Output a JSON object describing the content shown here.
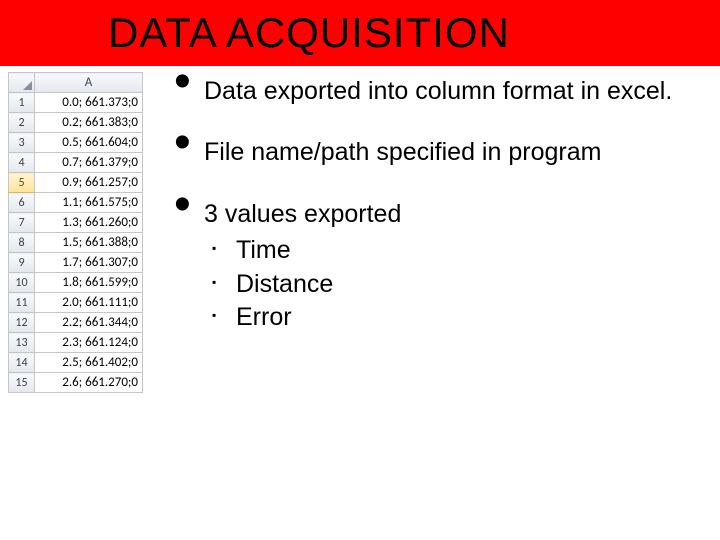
{
  "title": "DATA ACQUISITION",
  "spreadsheet": {
    "column_letter": "A",
    "selected_row_index": 4,
    "rows": [
      {
        "num": "1",
        "val": "0.0; 661.373;0"
      },
      {
        "num": "2",
        "val": "0.2; 661.383;0"
      },
      {
        "num": "3",
        "val": "0.5; 661.604;0"
      },
      {
        "num": "4",
        "val": "0.7; 661.379;0"
      },
      {
        "num": "5",
        "val": "0.9; 661.257;0"
      },
      {
        "num": "6",
        "val": "1.1; 661.575;0"
      },
      {
        "num": "7",
        "val": "1.3; 661.260;0"
      },
      {
        "num": "8",
        "val": "1.5; 661.388;0"
      },
      {
        "num": "9",
        "val": "1.7; 661.307;0"
      },
      {
        "num": "10",
        "val": "1.8; 661.599;0"
      },
      {
        "num": "11",
        "val": "2.0; 661.111;0"
      },
      {
        "num": "12",
        "val": "2.2; 661.344;0"
      },
      {
        "num": "13",
        "val": "2.3; 661.124;0"
      },
      {
        "num": "14",
        "val": "2.5; 661.402;0"
      },
      {
        "num": "15",
        "val": "2.6; 661.270;0"
      }
    ]
  },
  "bullets": {
    "b1": "Data exported into column format in excel.",
    "b2": "File name/path specified in program",
    "b3": "3 values exported",
    "sub1": "Time",
    "sub2": "Distance",
    "sub3": "Error"
  }
}
